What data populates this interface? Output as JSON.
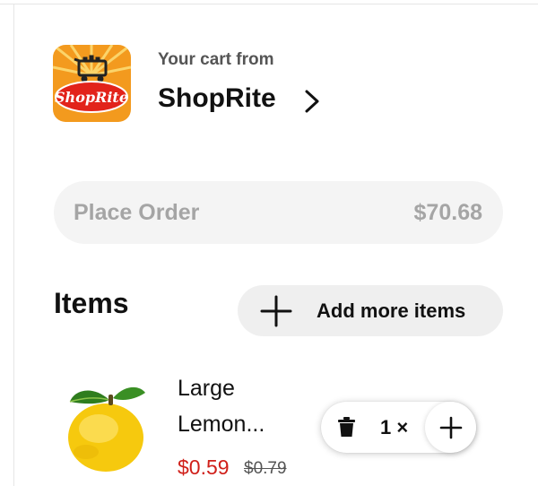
{
  "header": {
    "subtitle": "Your cart from",
    "store_name": "ShopRite",
    "logo_text": "ShopRite"
  },
  "checkout": {
    "place_order_label": "Place Order",
    "total": "$70.68"
  },
  "items_section": {
    "heading": "Items",
    "add_more_label": "Add more items"
  },
  "cart_items": [
    {
      "name": "Large Lemon...",
      "price": "$0.59",
      "original_price": "$0.79",
      "quantity": "1 ×",
      "image_icon": "lemon-icon"
    }
  ],
  "colors": {
    "sale_price": "#d0201a",
    "logo_orange": "#f39a1e",
    "logo_red": "#e2231a",
    "disabled_button_bg": "#f4f4f4",
    "disabled_button_text": "#a5a5a5"
  }
}
